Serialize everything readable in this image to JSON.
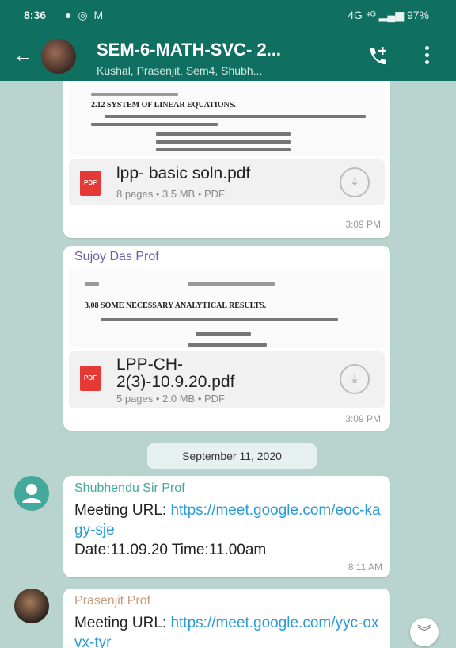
{
  "status_bar": {
    "time": "8:36",
    "notification_icons": [
      "whatsapp-icon",
      "instagram-icon",
      "gmail-icon"
    ],
    "right_text": "4G ⁴ᴳ ▂▄▆ 97%"
  },
  "header": {
    "title": "SEM-6-MATH-SVC- 2...",
    "subtitle": "Kushal, Prasenjit, Sem4, Shubh..."
  },
  "colors": {
    "header": "#0f6f61",
    "background": "#b9d3cf",
    "link": "#2a9bd8",
    "sender1": "#43a99a",
    "sender2": "#6c5ea8",
    "sender3": "#c89b7d"
  },
  "messages": [
    {
      "preview_heading": "2.12   SYSTEM OF LINEAR EQUATIONS.",
      "file_name": "lpp- basic soln.pdf",
      "file_meta": "8 pages • 3.5 MB • PDF",
      "time": "3:09 PM"
    },
    {
      "sender": "Sujoy Das Prof",
      "preview_heading": "3.08   SOME NECESSARY ANALYTICAL RESULTS.",
      "file_name": "LPP-CH-2(3)-10.9.20.pdf",
      "file_meta": "5 pages • 2.0 MB • PDF",
      "time": "3:09 PM"
    }
  ],
  "date_divider": "September 11, 2020",
  "text_messages": [
    {
      "sender": "Shubhendu Sir Prof",
      "label": "Meeting URL: ",
      "link": "https://meet.google.com/eoc-kagy-sje",
      "extra": "Date:11.09.20  Time:11.00am",
      "time": "8:11 AM"
    },
    {
      "sender": "Prasenjit Prof",
      "label": "Meeting URL: ",
      "link": "https://meet.google.com/yyc-oxvx-tyr"
    }
  ],
  "pdf_icon_label": "PDF"
}
